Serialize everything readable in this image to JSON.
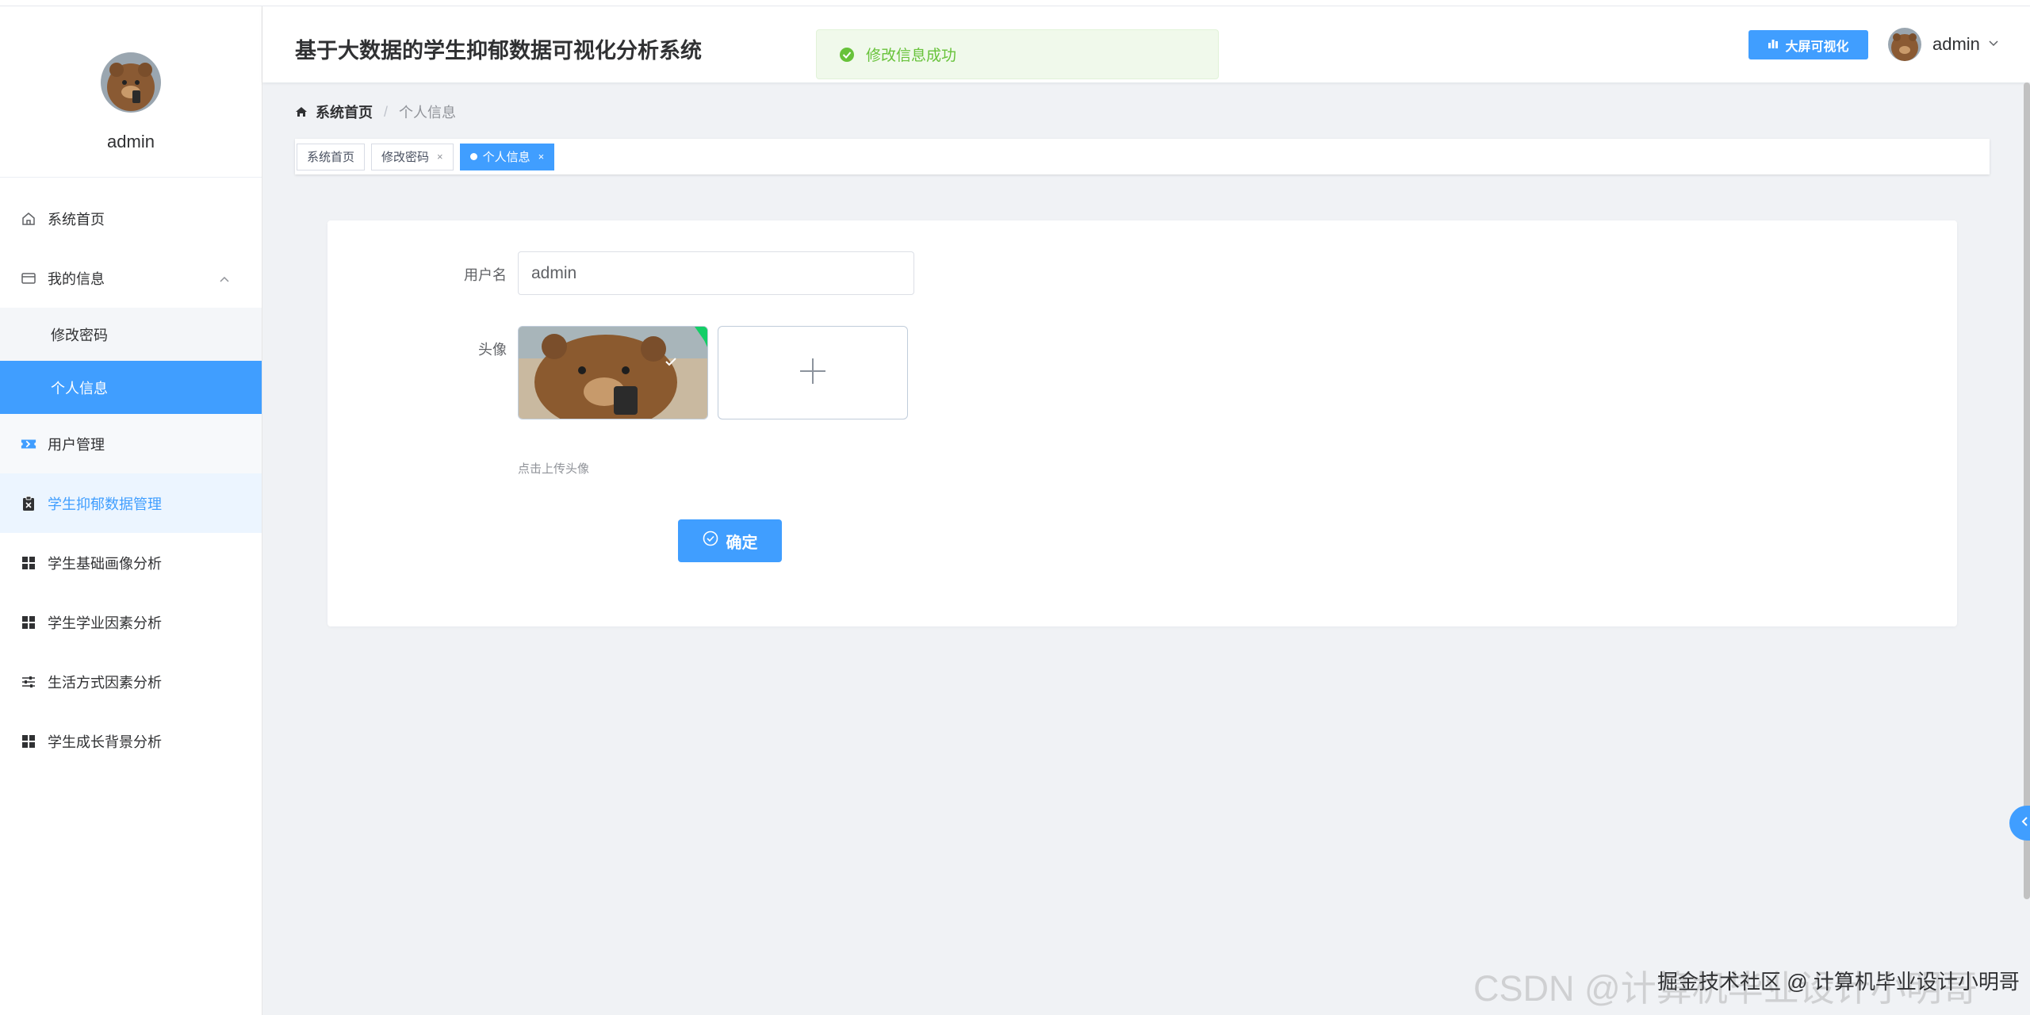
{
  "app": {
    "title": "基于大数据的学生抑郁数据可视化分析系统"
  },
  "toast": {
    "message": "修改信息成功",
    "type": "success"
  },
  "header": {
    "big_screen_label": "大屏可视化",
    "username": "admin"
  },
  "sidebar": {
    "profile_name": "admin",
    "items": [
      {
        "label": "系统首页",
        "icon": "home-icon"
      },
      {
        "label": "我的信息",
        "icon": "id-card-icon",
        "expanded": true,
        "children": [
          {
            "label": "修改密码"
          },
          {
            "label": "个人信息",
            "active": true
          }
        ]
      },
      {
        "label": "用户管理",
        "icon": "ticket-icon"
      },
      {
        "label": "学生抑郁数据管理",
        "icon": "clipboard-icon",
        "highlighted": true
      },
      {
        "label": "学生基础画像分析",
        "icon": "grid-icon"
      },
      {
        "label": "学生学业因素分析",
        "icon": "grid-icon"
      },
      {
        "label": "生活方式因素分析",
        "icon": "sliders-icon"
      },
      {
        "label": "学生成长背景分析",
        "icon": "grid-icon"
      }
    ]
  },
  "breadcrumb": {
    "home": "系统首页",
    "separator": "/",
    "current": "个人信息"
  },
  "tags": [
    {
      "label": "系统首页",
      "closable": false,
      "active": false
    },
    {
      "label": "修改密码",
      "closable": true,
      "active": false
    },
    {
      "label": "个人信息",
      "closable": true,
      "active": true
    }
  ],
  "tag_close_glyph": "×",
  "form": {
    "username_label": "用户名",
    "username_value": "admin",
    "avatar_label": "头像",
    "upload_tip": "点击上传头像",
    "upload_plus": "+",
    "confirm_label": "确定"
  },
  "watermark": {
    "csdn": "CSDN @计算机毕业设计小明哥",
    "juejin": "掘金技术社区 @ 计算机毕业设计小明哥"
  },
  "colors": {
    "primary": "#409eff",
    "success": "#67c23a",
    "success_bg": "#f0f9eb",
    "page_bg": "#f0f2f5"
  }
}
